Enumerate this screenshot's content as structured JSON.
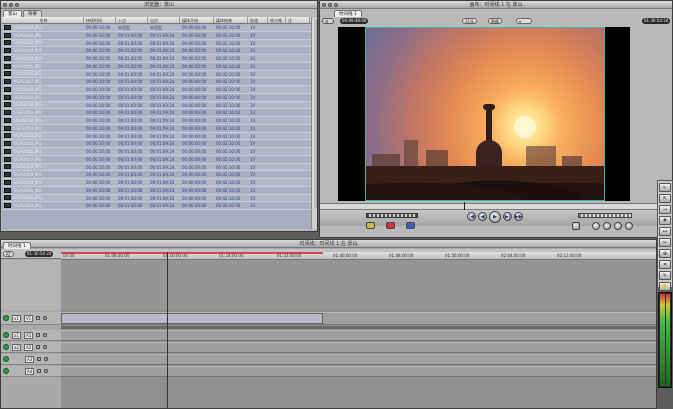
{
  "browser": {
    "title": "浏览器：景山",
    "tabs": [
      "景山",
      "效果"
    ],
    "columns": [
      "名称",
      "持续时间",
      "入点",
      "出点",
      "媒体开始",
      "媒体结束",
      "轨道",
      "帧方格",
      "注"
    ],
    "rows": [
      {
        "name": "YA3A2440.JPG",
        "duration": "00:00:10:00",
        "in": "未设定",
        "out": "未设定",
        "media_start": "00:00:00:00",
        "media_end": "00:02:10:00",
        "tracks": "1V"
      },
      {
        "name": "YA3A2441.JPG",
        "duration": "00:00:10:00",
        "in": "00:01:00:00",
        "out": "00:01:09:24",
        "media_start": "00:00:00:00",
        "media_end": "00:02:10:00",
        "tracks": "1V"
      },
      {
        "name": "YA3A2442.JPG",
        "duration": "00:00:10:00",
        "in": "00:01:00:00",
        "out": "00:01:09:24",
        "media_start": "00:00:00:00",
        "media_end": "00:02:10:00",
        "tracks": "1V"
      },
      {
        "name": "YA3A2443.JPG",
        "duration": "00:00:10:00",
        "in": "00:01:00:00",
        "out": "00:01:09:24",
        "media_start": "00:00:00:00",
        "media_end": "00:02:10:00",
        "tracks": "1V"
      },
      {
        "name": "YA3A2444.JPG",
        "duration": "00:00:10:00",
        "in": "00:01:00:00",
        "out": "00:01:09:24",
        "media_start": "00:00:00:00",
        "media_end": "00:02:10:00",
        "tracks": "1V"
      },
      {
        "name": "YA3A2445.JPG",
        "duration": "00:00:10:00",
        "in": "00:01:00:00",
        "out": "00:01:09:24",
        "media_start": "00:00:00:00",
        "media_end": "00:02:10:00",
        "tracks": "1V"
      },
      {
        "name": "YA3A2446.JPG",
        "duration": "00:00:10:00",
        "in": "00:01:00:00",
        "out": "00:01:09:24",
        "media_start": "00:00:00:00",
        "media_end": "00:02:10:00",
        "tracks": "1V"
      },
      {
        "name": "YA3A2447.JPG",
        "duration": "00:00:10:00",
        "in": "00:01:00:00",
        "out": "00:01:09:24",
        "media_start": "00:00:00:00",
        "media_end": "00:02:10:00",
        "tracks": "1V"
      },
      {
        "name": "YA3A2448.JPG",
        "duration": "00:00:10:00",
        "in": "00:01:00:00",
        "out": "00:01:09:24",
        "media_start": "00:00:00:00",
        "media_end": "00:02:10:00",
        "tracks": "1V"
      },
      {
        "name": "YA3A2449.JPG",
        "duration": "00:00:10:00",
        "in": "00:01:00:00",
        "out": "00:01:09:24",
        "media_start": "00:00:00:00",
        "media_end": "00:02:10:00",
        "tracks": "1V"
      },
      {
        "name": "YA3A2450.JPG",
        "duration": "00:00:10:00",
        "in": "00:01:00:00",
        "out": "00:01:09:24",
        "media_start": "00:00:00:00",
        "media_end": "00:02:10:00",
        "tracks": "1V"
      },
      {
        "name": "YA3A2451.JPG",
        "duration": "00:00:10:00",
        "in": "00:01:00:00",
        "out": "00:01:09:24",
        "media_start": "00:00:00:00",
        "media_end": "00:02:10:00",
        "tracks": "1V"
      },
      {
        "name": "YA3A2452.JPG",
        "duration": "00:00:10:00",
        "in": "00:01:00:00",
        "out": "00:01:09:24",
        "media_start": "00:00:00:00",
        "media_end": "00:02:10:00",
        "tracks": "1V"
      },
      {
        "name": "YA3A2453.JPG",
        "duration": "00:00:10:00",
        "in": "00:01:00:00",
        "out": "00:01:09:24",
        "media_start": "00:00:00:00",
        "media_end": "00:02:10:00",
        "tracks": "1V"
      },
      {
        "name": "YA3A2454.JPG",
        "duration": "00:00:10:00",
        "in": "00:01:00:00",
        "out": "00:01:09:24",
        "media_start": "00:00:00:00",
        "media_end": "00:02:10:00",
        "tracks": "1V"
      },
      {
        "name": "YA3A2455.JPG",
        "duration": "00:00:10:00",
        "in": "00:01:00:00",
        "out": "00:01:09:24",
        "media_start": "00:00:00:00",
        "media_end": "00:02:10:00",
        "tracks": "1V"
      },
      {
        "name": "YA3A2456.JPG",
        "duration": "00:00:10:00",
        "in": "00:01:00:00",
        "out": "00:01:09:24",
        "media_start": "00:00:00:00",
        "media_end": "00:02:10:00",
        "tracks": "1V"
      },
      {
        "name": "YA3A2457.JPG",
        "duration": "00:00:10:00",
        "in": "00:01:00:00",
        "out": "00:01:09:24",
        "media_start": "00:00:00:00",
        "media_end": "00:02:10:00",
        "tracks": "1V"
      },
      {
        "name": "YA3A2458.JPG",
        "duration": "00:00:10:00",
        "in": "00:01:00:00",
        "out": "00:01:09:24",
        "media_start": "00:00:00:00",
        "media_end": "00:02:10:00",
        "tracks": "1V"
      },
      {
        "name": "YA3A2459.JPG",
        "duration": "00:00:10:00",
        "in": "00:01:00:00",
        "out": "00:01:09:24",
        "media_start": "00:00:00:00",
        "media_end": "00:02:10:00",
        "tracks": "1V"
      },
      {
        "name": "YA3A2460.JPG",
        "duration": "00:00:10:00",
        "in": "00:01:00:00",
        "out": "00:01:09:24",
        "media_start": "00:00:00:00",
        "media_end": "00:02:10:00",
        "tracks": "1V"
      },
      {
        "name": "YA3A2461.JPG",
        "duration": "00:00:10:00",
        "in": "00:01:00:00",
        "out": "00:01:09:24",
        "media_start": "00:00:00:00",
        "media_end": "00:02:10:00",
        "tracks": "1V"
      },
      {
        "name": "YA3A2462.JPG",
        "duration": "00:00:10:00",
        "in": "00:01:00:00",
        "out": "00:01:09:24",
        "media_start": "00:00:00:00",
        "media_end": "00:02:10:00",
        "tracks": "1V"
      },
      {
        "name": "YA3A2463.JPG",
        "duration": "00:00:10:00",
        "in": "00:01:00:00",
        "out": "00:01:09:24",
        "media_start": "00:00:00:00",
        "media_end": "00:02:10:00",
        "tracks": "1V"
      }
    ]
  },
  "canvas": {
    "title": "画布：时间线 1 在 景山",
    "tab": "时间线 1",
    "zoom": "31%",
    "view": "图像",
    "timecode_left": "00:09:48:00",
    "timecode_right": "01:30:54:24"
  },
  "timeline": {
    "title": "时间线：时间线 1 在 景山",
    "tab": "时间线 1",
    "menu": "RT",
    "current_timecode": "01:30:54:24",
    "ruler_ticks": [
      "00:00",
      "01:08:00:00",
      "01:16:00:00",
      "01:24:00:00",
      "01:32:00:00",
      "01:40:00:00",
      "01:48:00:00",
      "01:56:00:00",
      "02:04:00:00",
      "02:12:00:00"
    ],
    "tracks": [
      {
        "source": "v1",
        "target": "V1",
        "type": "video"
      },
      {
        "source": "a1",
        "target": "A1",
        "type": "audio"
      },
      {
        "source": "a2",
        "target": "A2",
        "type": "audio"
      },
      {
        "source": "",
        "target": "A3",
        "type": "audio"
      },
      {
        "source": "",
        "target": "A4",
        "type": "audio"
      }
    ]
  },
  "colors": {
    "accent_blue": "#2a3d8a",
    "canvas_border": "#3bb6a6",
    "track_green": "#2b9a4a"
  }
}
